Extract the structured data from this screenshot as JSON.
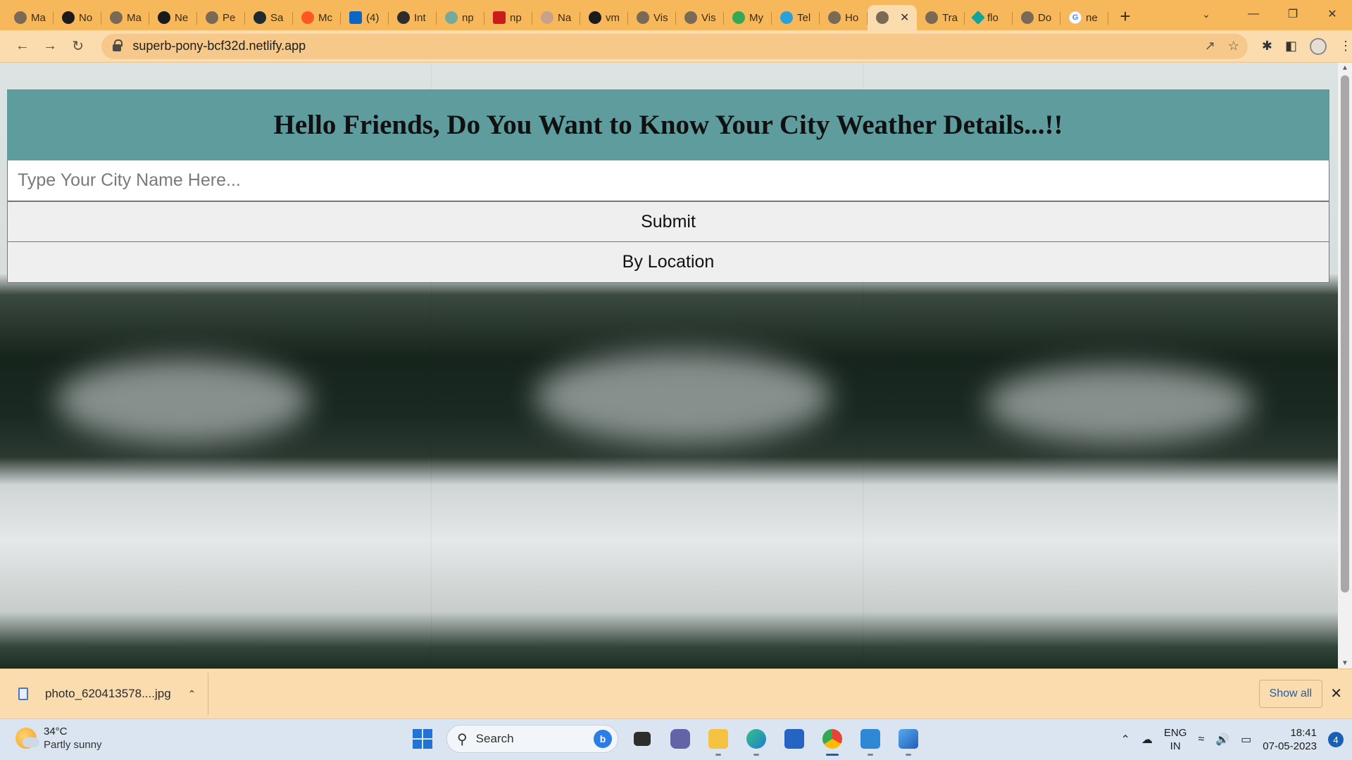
{
  "browser": {
    "tabs": [
      {
        "label": "Ma",
        "icon": "globe-icon"
      },
      {
        "label": "No",
        "icon": "github-icon"
      },
      {
        "label": "Ma",
        "icon": "globe-icon"
      },
      {
        "label": "Ne",
        "icon": "github-icon"
      },
      {
        "label": "Pe",
        "icon": "globe-icon"
      },
      {
        "label": "Sa",
        "icon": "react-icon"
      },
      {
        "label": "Mc",
        "icon": "medium-icon"
      },
      {
        "label": "(4)",
        "icon": "linkedin-icon"
      },
      {
        "label": "Int",
        "icon": "instagram-icon"
      },
      {
        "label": "np",
        "icon": "chatgpt-icon"
      },
      {
        "label": "np",
        "icon": "npm-icon"
      },
      {
        "label": "Na",
        "icon": "avatar-icon"
      },
      {
        "label": "vm",
        "icon": "github-icon"
      },
      {
        "label": "Vis",
        "icon": "globe-icon"
      },
      {
        "label": "Vis",
        "icon": "globe-icon"
      },
      {
        "label": "My",
        "icon": "drive-icon"
      },
      {
        "label": "Tel",
        "icon": "telegram-icon"
      },
      {
        "label": "Ho",
        "icon": "globe-icon"
      },
      {
        "label": "",
        "icon": "globe-icon",
        "active": true
      },
      {
        "label": "Tra",
        "icon": "globe-icon"
      },
      {
        "label": "flo",
        "icon": "diamond-icon"
      },
      {
        "label": "Do",
        "icon": "globe-icon"
      },
      {
        "label": "ne",
        "icon": "google-icon"
      }
    ],
    "url": "superb-pony-bcf32d.netlify.app"
  },
  "app": {
    "title": "Hello Friends, Do You Want to Know Your City Weather Details...!!",
    "city_placeholder": "Type Your City Name Here...",
    "city_value": "",
    "submit_label": "Submit",
    "location_label": "By Location",
    "header_color": "#5e9c9e"
  },
  "downloads": {
    "file_name": "photo_620413578....jpg",
    "show_all_label": "Show all"
  },
  "taskbar": {
    "weather_temp": "34°C",
    "weather_condition": "Partly sunny",
    "search_label": "Search",
    "language_line1": "ENG",
    "language_line2": "IN",
    "time": "18:41",
    "date": "07-05-2023",
    "notification_count": "4"
  }
}
